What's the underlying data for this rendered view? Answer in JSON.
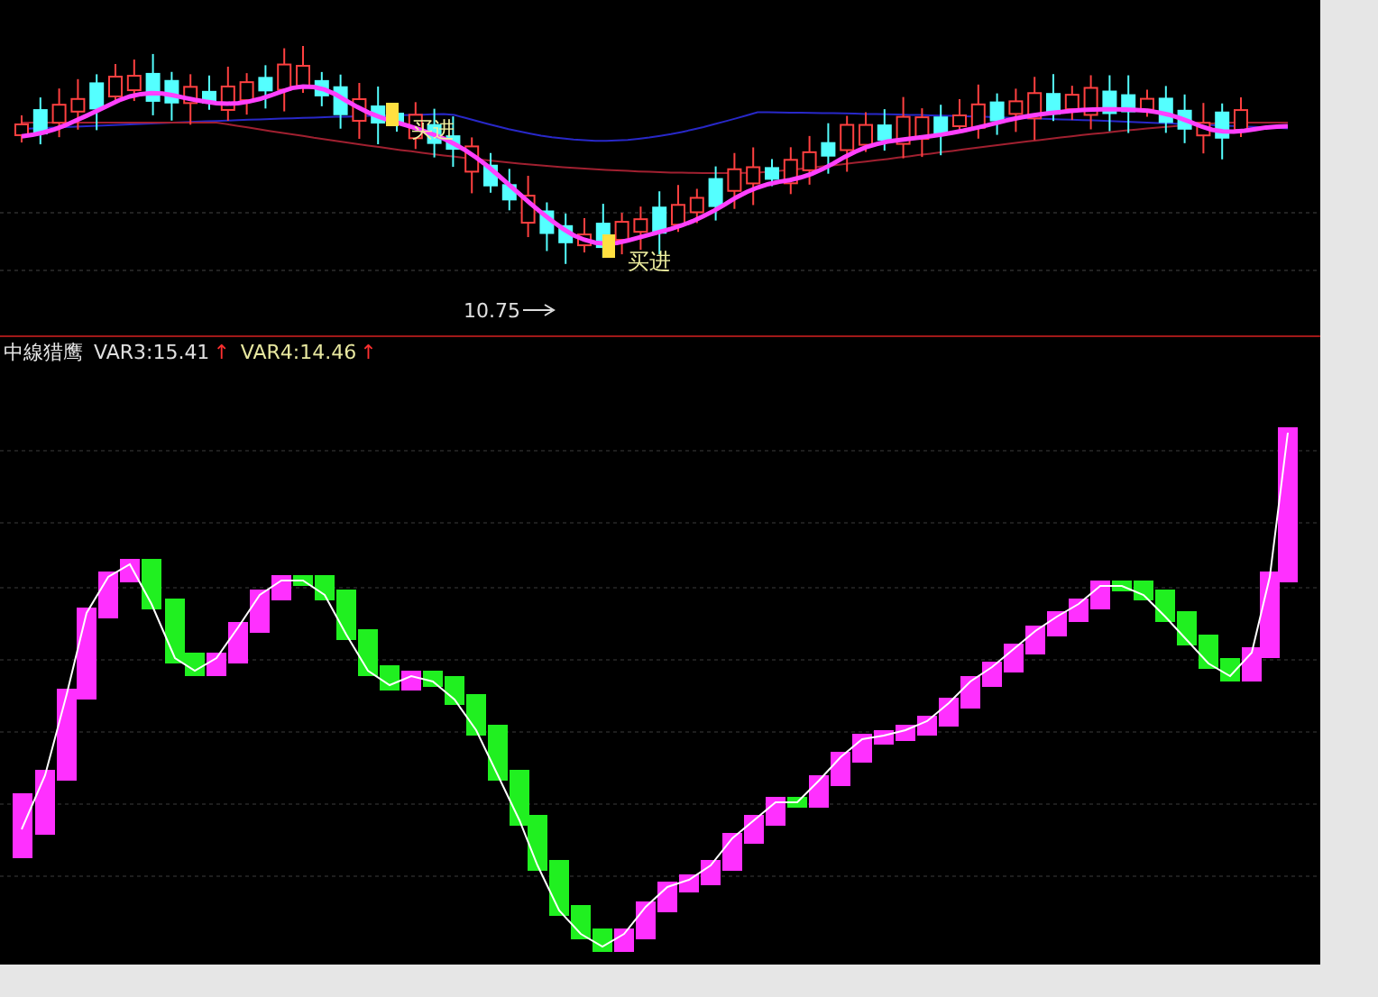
{
  "price_panel": {
    "signals": [
      {
        "label": "买进"
      },
      {
        "label": "买进"
      }
    ],
    "low_label": "10.75"
  },
  "indicator_panel": {
    "title": "中線猎鹰",
    "readings": [
      {
        "text": "VAR3:15.41",
        "arrow": "↑"
      },
      {
        "text": "VAR4:14.46",
        "arrow": "↑"
      }
    ]
  }
}
